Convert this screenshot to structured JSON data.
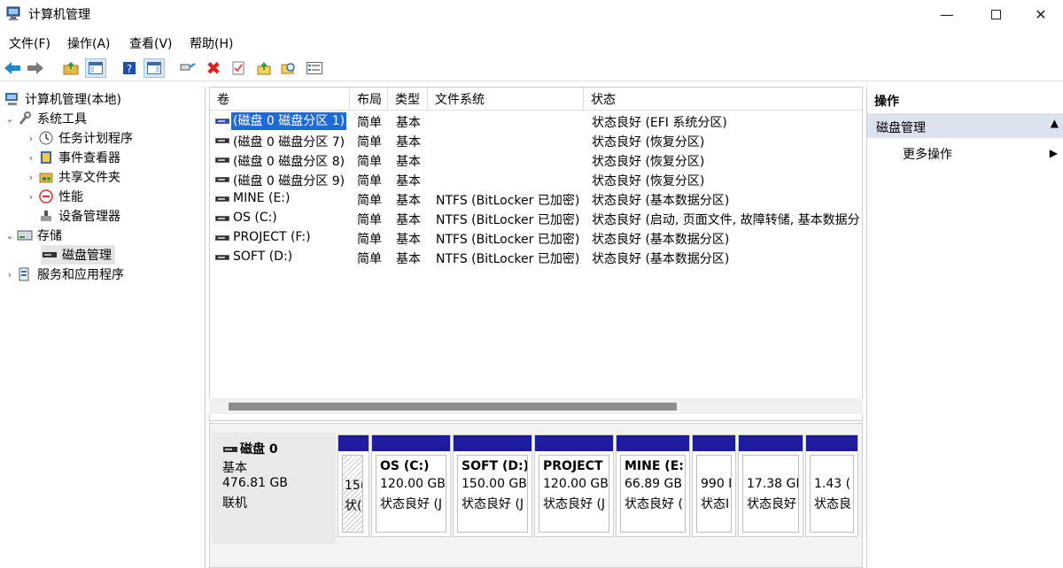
{
  "window": {
    "title": "计算机管理"
  },
  "menu": [
    "文件(F)",
    "操作(A)",
    "查看(V)",
    "帮助(H)"
  ],
  "tree": {
    "root": "计算机管理(本地)",
    "system_tools": "系统工具",
    "task_scheduler": "任务计划程序",
    "event_viewer": "事件查看器",
    "shared_folders": "共享文件夹",
    "performance": "性能",
    "device_manager": "设备管理器",
    "storage": "存储",
    "disk_management": "磁盘管理",
    "services": "服务和应用程序"
  },
  "columns": [
    "卷",
    "布局",
    "类型",
    "文件系统",
    "状态"
  ],
  "volumes": [
    {
      "name": "(磁盘 0 磁盘分区 1)",
      "layout": "简单",
      "type": "基本",
      "fs": "",
      "status": "状态良好 (EFI 系统分区)"
    },
    {
      "name": "(磁盘 0 磁盘分区 7)",
      "layout": "简单",
      "type": "基本",
      "fs": "",
      "status": "状态良好 (恢复分区)"
    },
    {
      "name": "(磁盘 0 磁盘分区 8)",
      "layout": "简单",
      "type": "基本",
      "fs": "",
      "status": "状态良好 (恢复分区)"
    },
    {
      "name": "(磁盘 0 磁盘分区 9)",
      "layout": "简单",
      "type": "基本",
      "fs": "",
      "status": "状态良好 (恢复分区)"
    },
    {
      "name": "MINE (E:)",
      "layout": "简单",
      "type": "基本",
      "fs": "NTFS (BitLocker 已加密)",
      "status": "状态良好 (基本数据分区)"
    },
    {
      "name": "OS (C:)",
      "layout": "简单",
      "type": "基本",
      "fs": "NTFS (BitLocker 已加密)",
      "status": "状态良好 (启动, 页面文件, 故障转储, 基本数据分"
    },
    {
      "name": "PROJECT (F:)",
      "layout": "简单",
      "type": "基本",
      "fs": "NTFS (BitLocker 已加密)",
      "status": "状态良好 (基本数据分区)"
    },
    {
      "name": "SOFT (D:)",
      "layout": "简单",
      "type": "基本",
      "fs": "NTFS (BitLocker 已加密)",
      "status": "状态良好 (基本数据分区)"
    }
  ],
  "disk": {
    "name": "磁盘 0",
    "type": "基本",
    "size": "476.81 GB",
    "state": "联机"
  },
  "partitions": [
    {
      "name": "",
      "size": "15(",
      "status": "状("
    },
    {
      "name": "OS  (C:)",
      "size": "120.00 GB",
      "status": "状态良好 (J"
    },
    {
      "name": "SOFT  (D:)",
      "size": "150.00 GB",
      "status": "状态良好 (J"
    },
    {
      "name": "PROJECT",
      "size": "120.00 GB",
      "status": "状态良好 (J"
    },
    {
      "name": "MINE  (E:",
      "size": "66.89 GB",
      "status": "状态良好 ("
    },
    {
      "name": "",
      "size": "990 I",
      "status": "状态I"
    },
    {
      "name": "",
      "size": "17.38 GI",
      "status": "状态良好"
    },
    {
      "name": "",
      "size": "1.43 (",
      "status": "状态良"
    }
  ],
  "actions": {
    "header": "操作",
    "section": "磁盘管理",
    "more": "更多操作"
  }
}
